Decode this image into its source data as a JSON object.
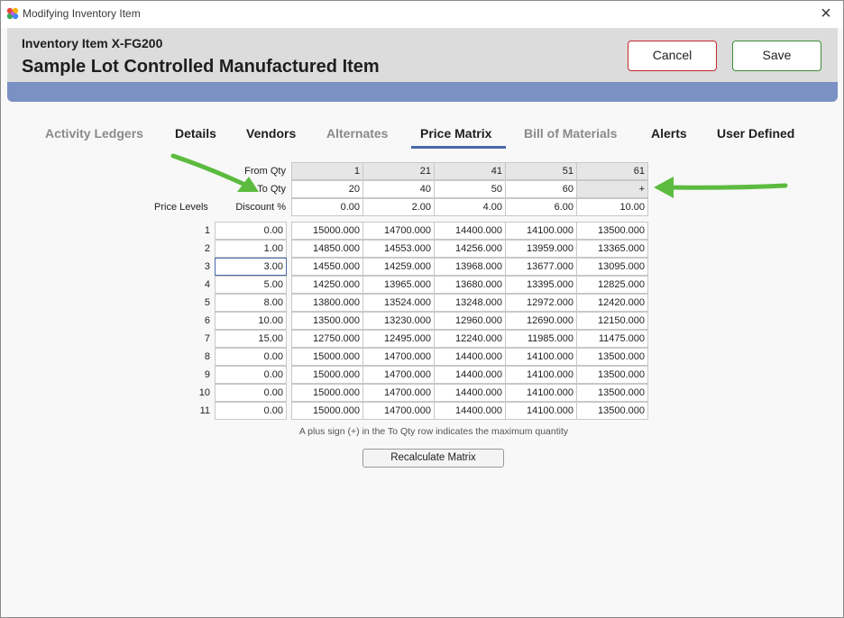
{
  "window": {
    "title": "Modifying Inventory Item",
    "close_glyph": "×"
  },
  "header": {
    "item_code": "Inventory Item X-FG200",
    "item_name": "Sample Lot Controlled Manufactured Item",
    "cancel_label": "Cancel",
    "save_label": "Save"
  },
  "colors": {
    "accent_bar": "#7b91c4",
    "cancel_border": "#c0282a",
    "save_border": "#3a8a34",
    "tab_underline": "#4b6aa8",
    "arrow_green": "#5cbb3f"
  },
  "tabs": [
    {
      "label": "Activity Ledgers",
      "state": "inactive"
    },
    {
      "label": "Details",
      "state": "normal"
    },
    {
      "label": "Vendors",
      "state": "normal"
    },
    {
      "label": "Alternates",
      "state": "inactive"
    },
    {
      "label": "Price Matrix",
      "state": "active"
    },
    {
      "label": "Bill of Materials",
      "state": "inactive"
    },
    {
      "label": "Alerts",
      "state": "normal"
    },
    {
      "label": "User Defined",
      "state": "normal"
    }
  ],
  "matrix": {
    "from_qty_label": "From Qty",
    "to_qty_label": "To Qty",
    "price_levels_label": "Price Levels",
    "discount_label": "Discount %",
    "from_qty": [
      "1",
      "21",
      "41",
      "51",
      "61"
    ],
    "to_qty": [
      "20",
      "40",
      "50",
      "60",
      "+"
    ],
    "column_discounts": [
      "0.00",
      "2.00",
      "4.00",
      "6.00",
      "10.00"
    ],
    "rows": [
      {
        "level": "1",
        "discount": "0.00",
        "prices": [
          "15000.000",
          "14700.000",
          "14400.000",
          "14100.000",
          "13500.000"
        ]
      },
      {
        "level": "2",
        "discount": "1.00",
        "prices": [
          "14850.000",
          "14553.000",
          "14256.000",
          "13959.000",
          "13365.000"
        ]
      },
      {
        "level": "3",
        "discount": "3.00",
        "prices": [
          "14550.000",
          "14259.000",
          "13968.000",
          "13677.000",
          "13095.000"
        ]
      },
      {
        "level": "4",
        "discount": "5.00",
        "prices": [
          "14250.000",
          "13965.000",
          "13680.000",
          "13395.000",
          "12825.000"
        ]
      },
      {
        "level": "5",
        "discount": "8.00",
        "prices": [
          "13800.000",
          "13524.000",
          "13248.000",
          "12972.000",
          "12420.000"
        ]
      },
      {
        "level": "6",
        "discount": "10.00",
        "prices": [
          "13500.000",
          "13230.000",
          "12960.000",
          "12690.000",
          "12150.000"
        ]
      },
      {
        "level": "7",
        "discount": "15.00",
        "prices": [
          "12750.000",
          "12495.000",
          "12240.000",
          "11985.000",
          "11475.000"
        ]
      },
      {
        "level": "8",
        "discount": "0.00",
        "prices": [
          "15000.000",
          "14700.000",
          "14400.000",
          "14100.000",
          "13500.000"
        ]
      },
      {
        "level": "9",
        "discount": "0.00",
        "prices": [
          "15000.000",
          "14700.000",
          "14400.000",
          "14100.000",
          "13500.000"
        ]
      },
      {
        "level": "10",
        "discount": "0.00",
        "prices": [
          "15000.000",
          "14700.000",
          "14400.000",
          "14100.000",
          "13500.000"
        ]
      },
      {
        "level": "11",
        "discount": "0.00",
        "prices": [
          "15000.000",
          "14700.000",
          "14400.000",
          "14100.000",
          "13500.000"
        ]
      }
    ],
    "note": "A plus sign (+) in the To Qty row indicates the maximum quantity",
    "recalculate_label": "Recalculate Matrix"
  }
}
